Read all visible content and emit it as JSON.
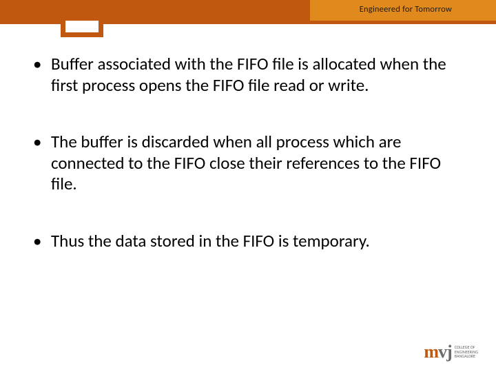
{
  "header": {
    "tagline": "Engineered for Tomorrow"
  },
  "bullets": [
    "Buffer associated with the FIFO file is allocated when the first process opens the FIFO file read or  write.",
    "The buffer is discarded when all process which are connected to the FIFO close their references to the FIFO file.",
    "Thus the data stored in the FIFO is temporary."
  ],
  "logo": {
    "prefix": "m",
    "suffix": "vj",
    "line1": "COLLEGE OF",
    "line2": "ENGINEERING",
    "line3": "BANGALORE"
  }
}
